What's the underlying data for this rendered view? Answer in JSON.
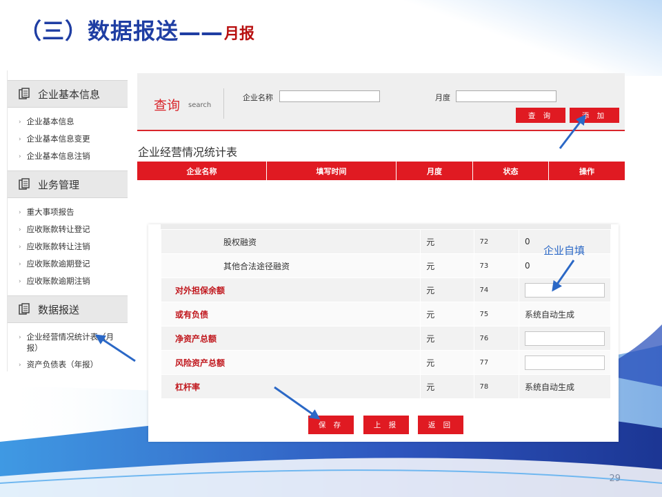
{
  "slide": {
    "title_main": "（三）数据报送",
    "title_dash": "——",
    "title_sub": "月报",
    "page_number": "29",
    "annotation": "企业自填"
  },
  "sidebar": {
    "groups": [
      {
        "title": "企业基本信息",
        "items": [
          "企业基本信息",
          "企业基本信息变更",
          "企业基本信息注销"
        ]
      },
      {
        "title": "业务管理",
        "items": [
          "重大事项报告",
          "应收账款转让登记",
          "应收账款转让注销",
          "应收账款逾期登记",
          "应收账款逾期注销"
        ]
      },
      {
        "title": "数据报送",
        "items": [
          "企业经营情况统计表（月报）",
          "资产负债表（年报）"
        ]
      }
    ]
  },
  "query": {
    "title": "查询",
    "title_en": "search",
    "company_label": "企业名称",
    "company_value": "",
    "month_label": "月度",
    "month_value": "",
    "search_button": "查 询",
    "add_button": "添 加"
  },
  "list": {
    "title": "企业经营情况统计表",
    "columns": [
      "企业名称",
      "填写时间",
      "月度",
      "状态",
      "操作"
    ]
  },
  "detail": {
    "rows": [
      {
        "name": "股权融资",
        "unit": "元",
        "code": "72",
        "value": "0",
        "style": "indent",
        "input": false
      },
      {
        "name": "其他合法途径融资",
        "unit": "元",
        "code": "73",
        "value": "0",
        "style": "indent",
        "input": false
      },
      {
        "name": "对外担保余额",
        "unit": "元",
        "code": "74",
        "value": "",
        "style": "red",
        "input": true
      },
      {
        "name": "或有负债",
        "unit": "元",
        "code": "75",
        "value": "系统自动生成",
        "style": "red",
        "input": false
      },
      {
        "name": "净资产总额",
        "unit": "元",
        "code": "76",
        "value": "",
        "style": "red",
        "input": true
      },
      {
        "name": "风险资产总额",
        "unit": "元",
        "code": "77",
        "value": "",
        "style": "red",
        "input": true
      },
      {
        "name": "杠杆率",
        "unit": "元",
        "code": "78",
        "value": "系统自动生成",
        "style": "red",
        "input": false
      }
    ],
    "buttons": {
      "save": "保 存",
      "report": "上 报",
      "back": "返 回"
    }
  },
  "colors": {
    "accent_red": "#e01a22",
    "title_blue": "#1f3ea3",
    "annotation_blue": "#2b68c6"
  }
}
